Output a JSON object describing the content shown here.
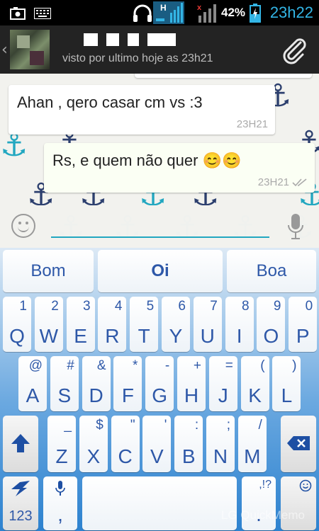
{
  "status_bar": {
    "battery_percent": "42%",
    "time": "23h22",
    "icons": [
      "screenshot-icon",
      "keyboard-icon",
      "headset-icon",
      "data-h-icon",
      "signal-icon",
      "battery-charging-icon"
    ]
  },
  "header": {
    "status_text": "visto por ultimo hoje as 23h21"
  },
  "messages": [
    {
      "direction": "in",
      "text": "Ahan , qero casar cm vs :3",
      "time": "23H21"
    },
    {
      "direction": "out",
      "text": "Rs,  e quem não quer 😊😊",
      "time": "23H21"
    }
  ],
  "input": {
    "value": "",
    "placeholder": ""
  },
  "keyboard": {
    "suggestions": [
      "Bom",
      "Oi",
      "Boa"
    ],
    "row1": [
      {
        "main": "Q",
        "sub": "1"
      },
      {
        "main": "W",
        "sub": "2"
      },
      {
        "main": "E",
        "sub": "3"
      },
      {
        "main": "R",
        "sub": "4"
      },
      {
        "main": "T",
        "sub": "5"
      },
      {
        "main": "Y",
        "sub": "6"
      },
      {
        "main": "U",
        "sub": "7"
      },
      {
        "main": "I",
        "sub": "8"
      },
      {
        "main": "O",
        "sub": "9"
      },
      {
        "main": "P",
        "sub": "0"
      }
    ],
    "row2": [
      {
        "main": "A",
        "sub": "@"
      },
      {
        "main": "S",
        "sub": "#"
      },
      {
        "main": "D",
        "sub": "&"
      },
      {
        "main": "F",
        "sub": "*"
      },
      {
        "main": "G",
        "sub": "-"
      },
      {
        "main": "H",
        "sub": "+"
      },
      {
        "main": "J",
        "sub": "="
      },
      {
        "main": "K",
        "sub": "("
      },
      {
        "main": "L",
        "sub": ")"
      }
    ],
    "row3": [
      {
        "main": "Z",
        "sub": "_"
      },
      {
        "main": "X",
        "sub": "$"
      },
      {
        "main": "C",
        "sub": "\""
      },
      {
        "main": "V",
        "sub": "'"
      },
      {
        "main": "B",
        "sub": ":"
      },
      {
        "main": "N",
        "sub": ";"
      },
      {
        "main": "M",
        "sub": "/"
      }
    ],
    "symbols_label": "123",
    "comma_label": ",",
    "period_label": ".",
    "punct_sub": ",!?",
    "watermark": "LG QuickMemo"
  },
  "colors": {
    "accent": "#22a7c0",
    "key_text": "#2e58a8",
    "time_blue": "#33b5e5"
  }
}
